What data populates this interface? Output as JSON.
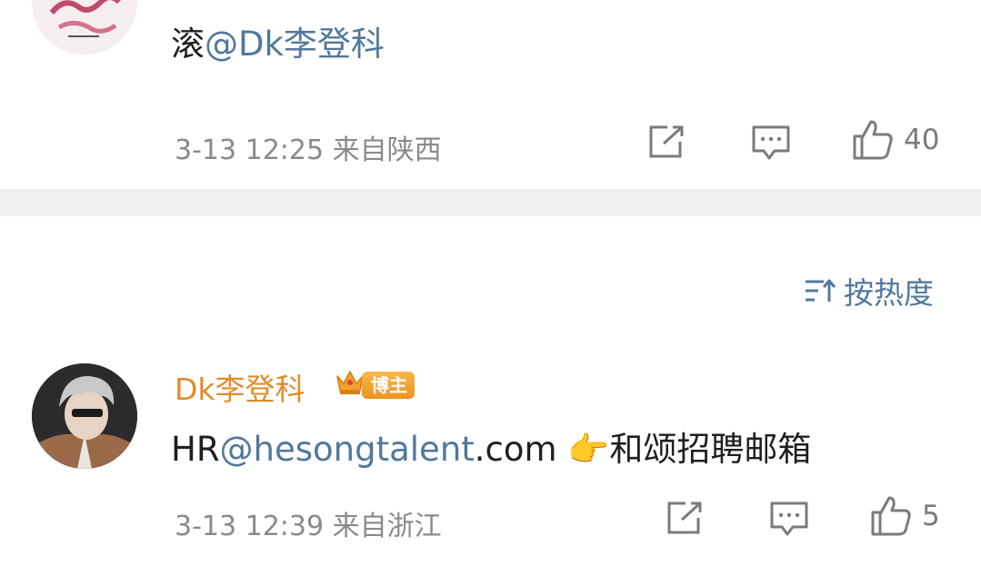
{
  "comments": [
    {
      "text_prefix": "滚",
      "mention": "@Dk李登科",
      "timestamp": "3-13 12:25",
      "location": "来自陕西",
      "likes": "40",
      "avatar_icon": "pink-calligraphy-avatar"
    },
    {
      "username": "Dk李登科",
      "badge": "博主",
      "text_prefix": "HR",
      "mention": "@hesongtalent",
      "text_suffix": ".com ",
      "emoji": "👉",
      "text_tail": "和颂招聘邮箱",
      "timestamp": "3-13 12:39",
      "location": "来自浙江",
      "likes": "5",
      "avatar_icon": "silver-hair-avatar"
    }
  ],
  "sort": {
    "label": "按热度",
    "icon": "sort-icon"
  },
  "colors": {
    "link": "#52789c",
    "username": "#e08c2a",
    "meta": "#8a8a8a",
    "divider": "#efefef"
  }
}
